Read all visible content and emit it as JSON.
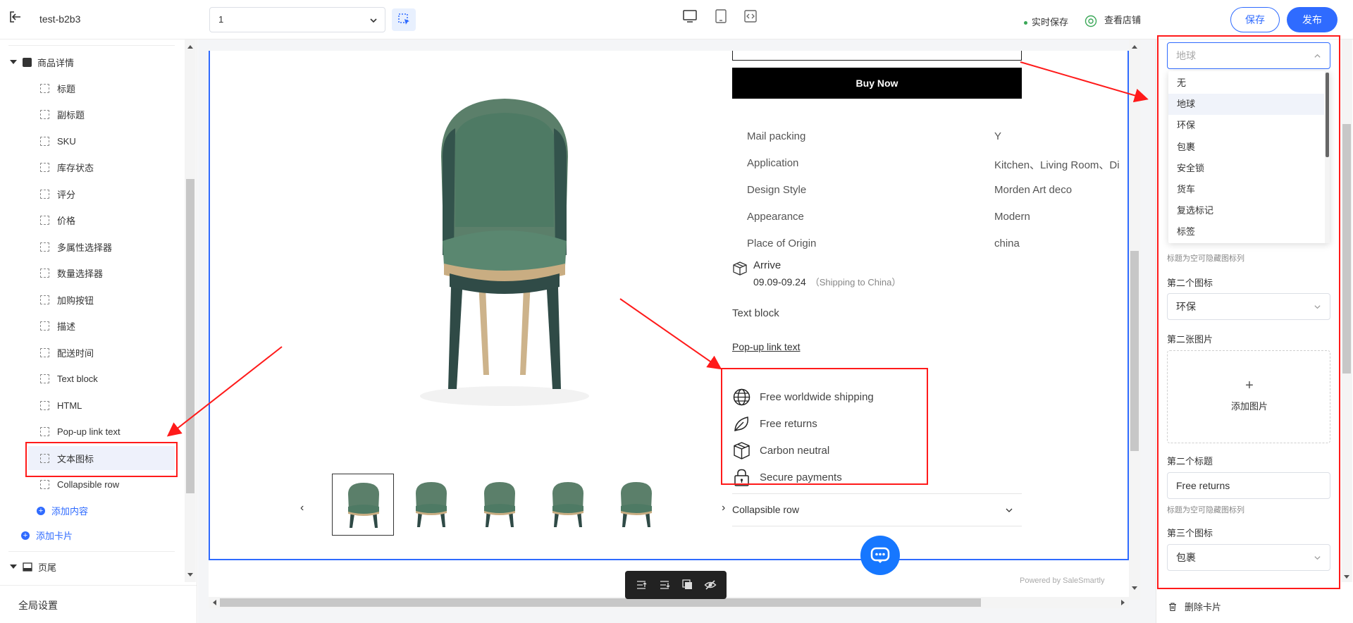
{
  "topbar": {
    "app_title": "test-b2b3",
    "page_select_value": "1",
    "autosave_label": "实时保存",
    "view_store_label": "查看店铺",
    "save_label": "保存",
    "publish_label": "发布"
  },
  "sidebar": {
    "section_product": "商品详情",
    "items": [
      {
        "label": "标题"
      },
      {
        "label": "副标题"
      },
      {
        "label": "SKU"
      },
      {
        "label": "库存状态"
      },
      {
        "label": "评分"
      },
      {
        "label": "价格"
      },
      {
        "label": "多属性选择器"
      },
      {
        "label": "数量选择器"
      },
      {
        "label": "加购按钮"
      },
      {
        "label": "描述"
      },
      {
        "label": "配送时间"
      },
      {
        "label": "Text block"
      },
      {
        "label": "HTML"
      },
      {
        "label": "Pop-up link text"
      },
      {
        "label": "文本图标"
      },
      {
        "label": "Collapsible row"
      }
    ],
    "selected_index": 14,
    "add_content": "添加内容",
    "add_card": "添加卡片",
    "section_footer": "页尾",
    "global_settings": "全局设置"
  },
  "product": {
    "buy_now": "Buy Now",
    "specs": [
      {
        "name": "Mail packing",
        "value": "Y"
      },
      {
        "name": "Application",
        "value": "Kitchen、Living Room、Di"
      },
      {
        "name": "Design Style",
        "value": "Morden Art deco"
      },
      {
        "name": "Appearance",
        "value": "Modern"
      },
      {
        "name": "Place of Origin",
        "value": "china"
      }
    ],
    "arrive_label": "Arrive",
    "arrive_dates": "09.09-09.24",
    "arrive_ship": "（Shipping to China）",
    "text_block": "Text block",
    "popup_link": "Pop-up link text",
    "icon_texts": [
      {
        "icon": "globe-icon",
        "text": "Free worldwide shipping"
      },
      {
        "icon": "leaf-icon",
        "text": "Free returns"
      },
      {
        "icon": "box-icon",
        "text": "Carbon neutral"
      },
      {
        "icon": "lock-icon",
        "text": "Secure payments"
      }
    ],
    "collapsible_row": "Collapsible row",
    "powered_by": "Powered by SaleSmartly",
    "thumb_prev": "‹",
    "thumb_next": "›"
  },
  "right_panel": {
    "first_icon_placeholder": "地球",
    "dropdown_options": [
      "无",
      "地球",
      "环保",
      "包裹",
      "安全锁",
      "货车",
      "复选标记",
      "标签"
    ],
    "dropdown_selected": "地球",
    "hint_1": "标题为空可隐藏图标列",
    "second_icon_label": "第二个图标",
    "second_icon_value": "环保",
    "second_image_label": "第二张图片",
    "upload_plus": "+",
    "upload_label": "添加图片",
    "second_title_label": "第二个标题",
    "second_title_value": "Free returns",
    "hint_2": "标题为空可隐藏图标列",
    "third_icon_label": "第三个图标",
    "third_icon_value": "包裹",
    "delete_card": "删除卡片"
  },
  "colors": {
    "accent": "#2f6bff",
    "annotation_red": "#ff1a1a",
    "chair_green": "#4e7a64"
  }
}
